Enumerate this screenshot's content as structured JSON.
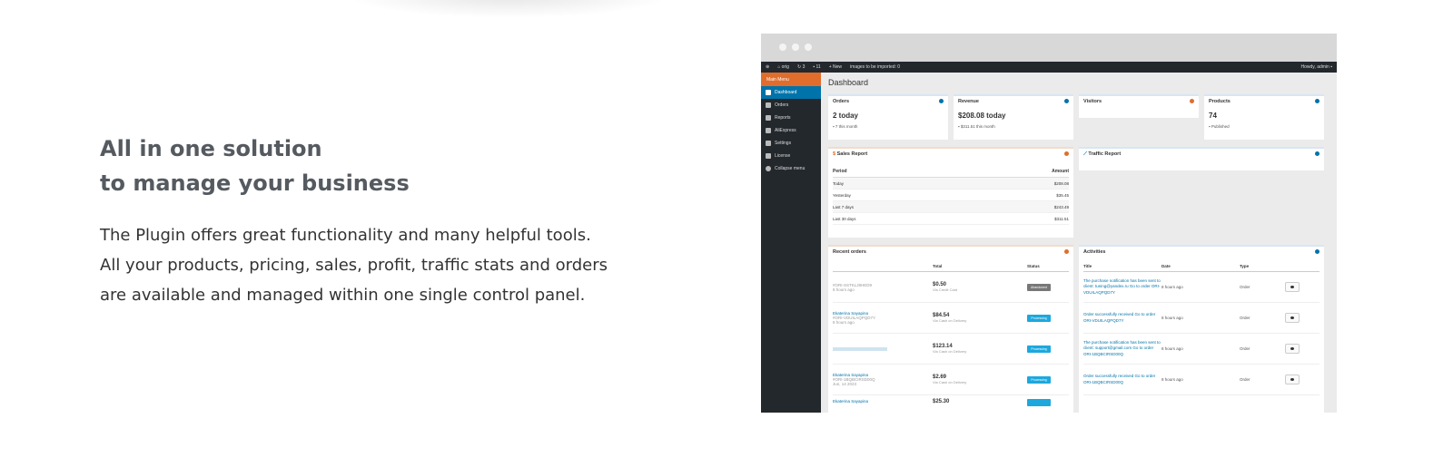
{
  "copy": {
    "headline_line1": "All in one solution",
    "headline_line2": "to manage your business",
    "desc_line1": "The Plugin offers great functionality and many helpful tools.",
    "desc_line2": "All your products, pricing, sales, profit, traffic stats and orders",
    "desc_line3": "are available and managed within one single control panel."
  },
  "adminbar": {
    "site": "orig",
    "updates": "3",
    "comments": "11",
    "new": "New",
    "notice": "images to be imported: 0",
    "howdy": "Howdy, admin"
  },
  "sidebar": {
    "top": "Main Menu",
    "items": [
      "Dashboard",
      "Orders",
      "Reports",
      "AliExpress",
      "Settings",
      "License",
      "Collapse menu"
    ]
  },
  "dashboard": {
    "title": "Dashboard",
    "cards": {
      "orders": {
        "title": "Orders",
        "value": "2 today",
        "sub": "7 this month"
      },
      "revenue": {
        "title": "Revenue",
        "value": "$208.08 today",
        "sub": "$311.51 this month"
      },
      "visitors": {
        "title": "Visitors"
      },
      "products": {
        "title": "Products",
        "value": "74",
        "sub": "Published"
      }
    },
    "sales_report": {
      "title": "Sales Report",
      "col_period": "Period",
      "col_amount": "Amount",
      "rows": [
        {
          "period": "Today",
          "amount": "$208.08"
        },
        {
          "period": "Yesterday",
          "amount": "$35.45"
        },
        {
          "period": "Last 7 days",
          "amount": "$243.49"
        },
        {
          "period": "Last 30 days",
          "amount": "$311.51"
        }
      ]
    },
    "traffic_report": {
      "title": "Traffic Report"
    },
    "recent_orders": {
      "title": "Recent orders",
      "col_total": "Total",
      "col_status": "Status",
      "rows": [
        {
          "name": "",
          "id": "#ORI-SSTKLJ8HED9",
          "time": "8 hours ago",
          "total": "$0.50",
          "pay": "Via Credit Card",
          "status": "Abandoned"
        },
        {
          "name": "Ekaterina Sayapina",
          "id": "#ORI-VDUILAQPQD7Y",
          "time": "8 hours ago",
          "total": "$84.54",
          "pay": "Via Cash on Delivery",
          "status": "Processing"
        },
        {
          "name": "",
          "id": "",
          "time": "",
          "total": "$123.14",
          "pay": "Via Cash on Delivery",
          "status": "Processing"
        },
        {
          "name": "Ekaterina Sayapina",
          "id": "#ORI-1BQBCIRSD00Q",
          "time": "Jun, 14 2023",
          "total": "$2.69",
          "pay": "Via Cash on Delivery",
          "status": "Processing"
        },
        {
          "name": "Ekaterina Sayapina",
          "id": "",
          "time": "",
          "total": "$25.30",
          "pay": "",
          "status": ""
        }
      ]
    },
    "activities": {
      "title": "Activities",
      "col_title": "Title",
      "col_date": "Date",
      "col_type": "Type",
      "rows": [
        {
          "text": "The purchase notification has been sent to client: tuning@yandex.ru Go to order ORI-VDUILAQPQD7Y",
          "date": "8 hours ago",
          "type": "Order"
        },
        {
          "text": "Order successfully received Go to order ORI-VDUILAQPQD7Y",
          "date": "8 hours ago",
          "type": "Order"
        },
        {
          "text": "The purchase notification has been sent to client: support@gmail.com Go to order ORI-1BQBCIRSD00Q",
          "date": "8 hours ago",
          "type": "Order"
        },
        {
          "text": "Order successfully received Go to order ORI-1BQBCIRSD00Q",
          "date": "8 hours ago",
          "type": "Order"
        }
      ]
    }
  },
  "colors": {
    "accent": "#0073aa",
    "orange": "#e06d2c",
    "adminbar": "#23282d",
    "badge": "#1ca8dd"
  }
}
